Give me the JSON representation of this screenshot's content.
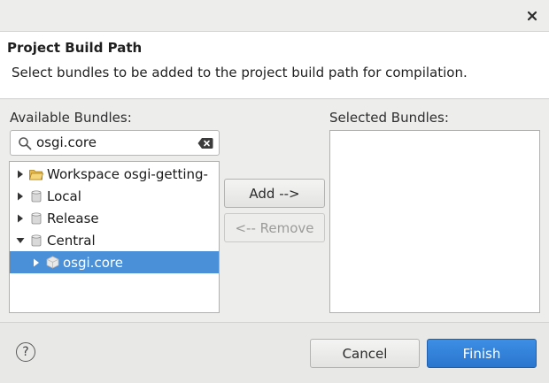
{
  "window": {
    "close_icon": "close-icon"
  },
  "header": {
    "title": "Project Build Path",
    "description": "Select bundles to be added to the project build path for compilation."
  },
  "available": {
    "label": "Available Bundles:",
    "search_value": "osgi.core",
    "search_icon": "search-icon",
    "clear_icon": "clear-text-icon",
    "tree": [
      {
        "label": "Workspace osgi-getting-",
        "expanded": false,
        "icon": "open-folder-icon",
        "level": 0
      },
      {
        "label": "Local",
        "expanded": false,
        "icon": "repository-icon",
        "level": 0
      },
      {
        "label": "Release",
        "expanded": false,
        "icon": "repository-icon",
        "level": 0
      },
      {
        "label": "Central",
        "expanded": true,
        "icon": "repository-icon",
        "level": 0
      },
      {
        "label": "osgi.core",
        "expanded": false,
        "icon": "bundle-icon",
        "level": 1,
        "selected": true
      }
    ]
  },
  "selected": {
    "label": "Selected Bundles:",
    "items": []
  },
  "buttons": {
    "add": "Add -->",
    "remove": "<-- Remove",
    "cancel": "Cancel",
    "finish": "Finish",
    "help": "?"
  },
  "colors": {
    "selection": "#4a90d9",
    "finish": "#2f7fd8"
  }
}
